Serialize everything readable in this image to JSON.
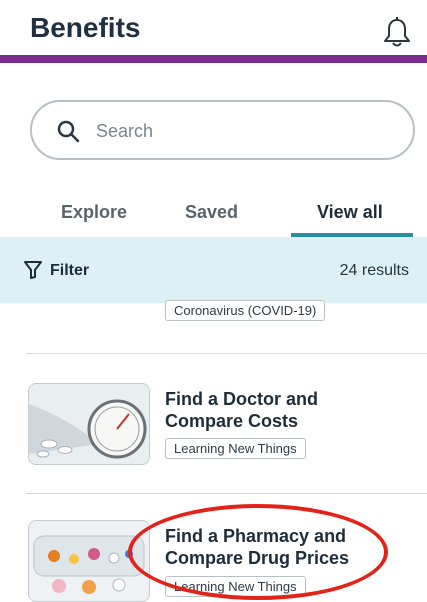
{
  "header": {
    "title": "Benefits",
    "notification_icon": "bell-icon"
  },
  "search": {
    "placeholder": "Search",
    "icon": "search-icon"
  },
  "tabs": [
    {
      "label": "Explore",
      "selected": false
    },
    {
      "label": "Saved",
      "selected": false
    },
    {
      "label": "View all",
      "selected": true
    }
  ],
  "filterbar": {
    "filter_label": "Filter",
    "results": "24 results",
    "filter_icon": "filter-icon"
  },
  "cards": [
    {
      "tag": "Coronavirus (COVID-19)"
    },
    {
      "title_line1": "Find a Doctor and",
      "title_line2": "Compare Costs",
      "tag": "Learning New Things",
      "image_icon": "blood-pressure-gauge-image"
    },
    {
      "title_line1": "Find a Pharmacy and",
      "title_line2": "Compare Drug Prices",
      "tag": "Learning New Things",
      "image_icon": "pills-organizer-image"
    }
  ],
  "colors": {
    "accent_purple": "#7b2c8f",
    "tab_underline": "#2a8da4",
    "filter_bg": "#ddf0f6",
    "annotation_red": "#e2231a"
  }
}
